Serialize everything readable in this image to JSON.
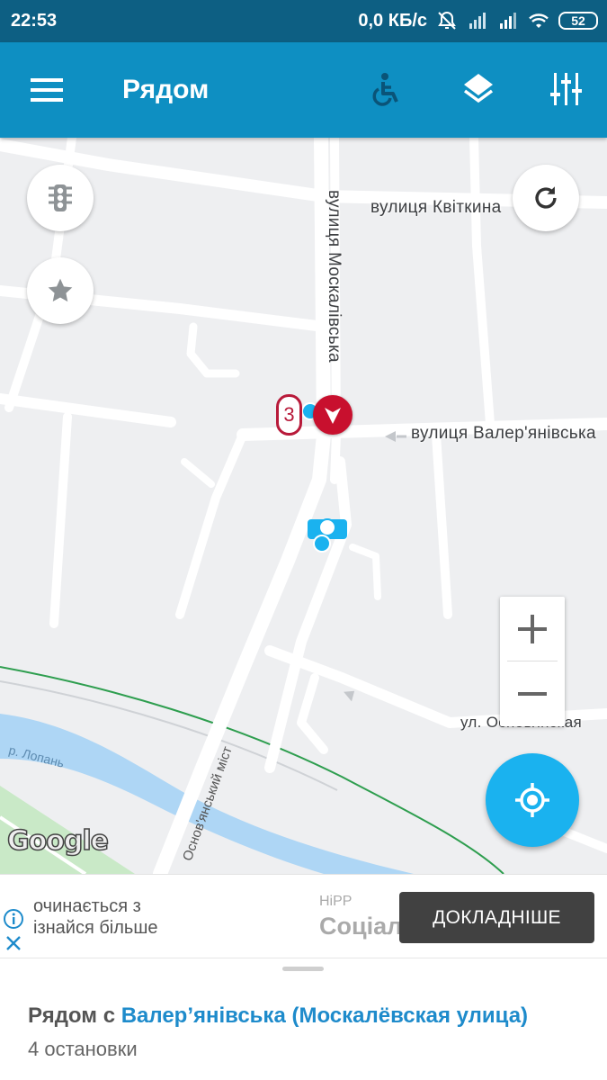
{
  "status_bar": {
    "time": "22:53",
    "net_speed": "0,0 КБ/с",
    "battery": "52"
  },
  "app_bar": {
    "title": "Рядом"
  },
  "map": {
    "labels": {
      "street_kvitkina": "вулиця Квіткина",
      "street_moskalivska": "вулиця Москалівська",
      "street_valerianivska": "вулиця Валер'янівська",
      "street_osnovianska": "ул. Основянская",
      "river": "р. Лопань",
      "bridge": "Основ'янський міст"
    },
    "stop_cluster_count": "3",
    "google_logo": "Google",
    "colors": {
      "background": "#eeeff1",
      "road": "#ffffff",
      "river": "#aed6f5",
      "park": "#c9e9c7",
      "rail": "#2e9e4f",
      "marker": "#c8102e",
      "fab": "#1ab2ef"
    }
  },
  "ad": {
    "line1": "очинається з",
    "line2": "ізнайся більше",
    "brand": "HiPP",
    "subtitle": "Соціал",
    "cta_label": "ДОКЛАДНІШЕ"
  },
  "sheet": {
    "title_prefix": "Рядом с ",
    "stop_name": "Валер’янівська (Москалёвская улица)",
    "subtitle": "4 остановки"
  },
  "icons": {
    "menu": "menu-icon",
    "accessibility": "wheelchair-icon",
    "layers": "layers-icon",
    "filters": "sliders-icon",
    "traffic": "traffic-light-icon",
    "favorites": "star-icon",
    "refresh": "refresh-icon",
    "locate": "crosshair-icon"
  }
}
